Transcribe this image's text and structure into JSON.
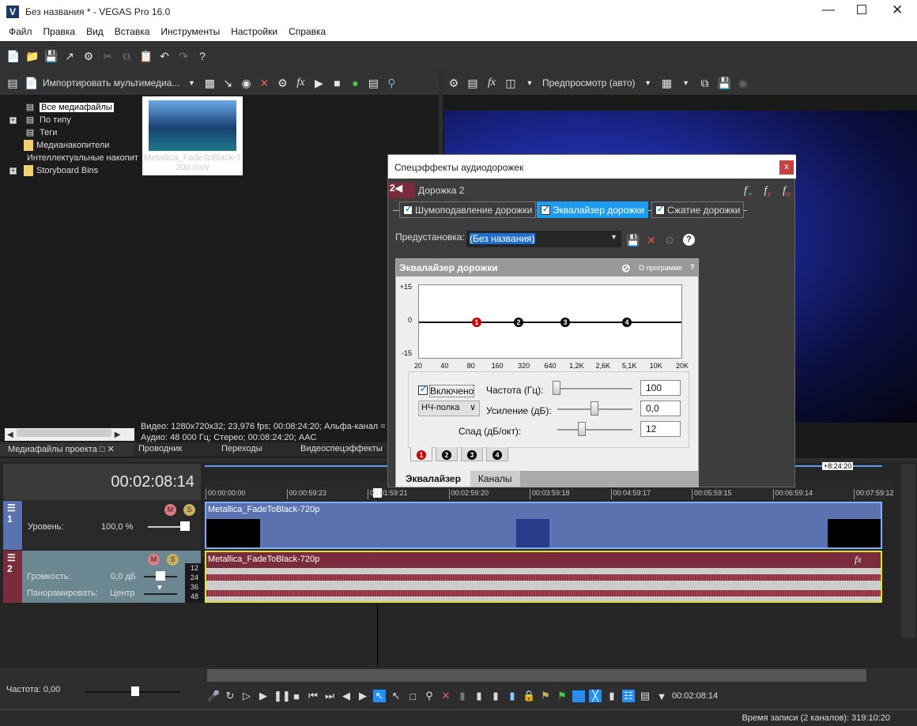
{
  "window": {
    "title": "Без названия * - VEGAS Pro 16.0",
    "app_icon": "V"
  },
  "menu": [
    "Файл",
    "Правка",
    "Вид",
    "Вставка",
    "Инструменты",
    "Настройки",
    "Справка"
  ],
  "media": {
    "import_label": "Импортировать мультимедиа...",
    "tree": [
      {
        "label": "Все медиафайлы",
        "expand": false,
        "selected": true
      },
      {
        "label": "По типу",
        "expand": true
      },
      {
        "label": "Теги",
        "expand": false
      },
      {
        "label": "Медианакопители",
        "expand": false
      },
      {
        "label": "Интеллектуальные накопители",
        "expand": false
      },
      {
        "label": "Storyboard Bins",
        "expand": true
      }
    ],
    "file_name": "Metallica_FadeToBlack-720p.mov",
    "info_video": "Видео: 1280x720x32; 23,976 fps; 00:08:24:20; Альфа-канал =",
    "info_audio": "Аудио: 48 000 Гц; Стерео; 00:08:24:20; AAC",
    "tabs": [
      "Медиафайлы проекта",
      "Проводник",
      "Переходы",
      "Видеоспецэффекты"
    ]
  },
  "preview": {
    "mode": "Предпросмотр (авто)"
  },
  "dialog": {
    "title": "Спецэффекты аудиодорожек",
    "close": "x",
    "track_num": "2",
    "track_name": "Дорожка 2",
    "chain": [
      {
        "label": "Шумоподавление дорожки",
        "active": false
      },
      {
        "label": "Эквалайзер дорожки",
        "active": true
      },
      {
        "label": "Сжатие дорожки",
        "active": false
      }
    ],
    "preset_label": "Предустановка:",
    "preset_value": "(Без названия)",
    "eq": {
      "title": "Эквалайзер дорожки",
      "about": "О программе",
      "help": "?",
      "y_ticks": [
        "+15",
        "0",
        "-15"
      ],
      "x_ticks": [
        "20",
        "40",
        "80",
        "160",
        "320",
        "640",
        "1,2K",
        "2,6K",
        "5,1K",
        "10K",
        "20K"
      ],
      "bands": [
        {
          "num": "1",
          "gain_db": 0,
          "active": true
        },
        {
          "num": "2",
          "gain_db": 0
        },
        {
          "num": "3",
          "gain_db": 0
        },
        {
          "num": "4",
          "gain_db": 0
        }
      ],
      "enabled_label": "Включено",
      "filter_type": "НЧ-полка",
      "freq_label": "Частота (Гц):",
      "freq_value": "100",
      "gain_label": "Усиление (дБ):",
      "gain_value": "0,0",
      "slope_label": "Спад (дБ/окт):",
      "slope_value": "12",
      "band_tabs": [
        "1",
        "2",
        "3",
        "4"
      ],
      "bottom_tabs": [
        "Эквалайзер",
        "Каналы"
      ]
    }
  },
  "timeline": {
    "time": "00:02:08:14",
    "end_marker": "+8:24:20",
    "ruler": [
      "00:00:00:00",
      "00:00:59:23",
      "00:01:59:21",
      "00:02:59:20",
      "00:03:59:18",
      "00:04:59:17",
      "00:05:59:15",
      "00:06:59:14",
      "00:07:59:12"
    ],
    "video_track": {
      "num": "1",
      "level_label": "Уровень:",
      "level_value": "100,0 %",
      "clip": "Metallica_FadeToBlack-720p"
    },
    "audio_track": {
      "num": "2",
      "vol_label": "Громкость:",
      "vol_value": "0,0 дБ",
      "pan_label": "Панорамировать:",
      "pan_value": "Центр",
      "clip": "Metallica_FadeToBlack-720p",
      "meter": [
        "12",
        "24",
        "36",
        "48"
      ]
    }
  },
  "bottom": {
    "rate_label": "Частота: 0,00",
    "cursor_time": "00:02:08:14"
  },
  "status": {
    "record_time": "Время записи (2 каналов): 319:10:20"
  },
  "colors": {
    "accent": "#1e90ff",
    "video_track": "#5a73b0",
    "audio_track": "#7a2c3c",
    "eq_band_active": "#cc0000"
  }
}
